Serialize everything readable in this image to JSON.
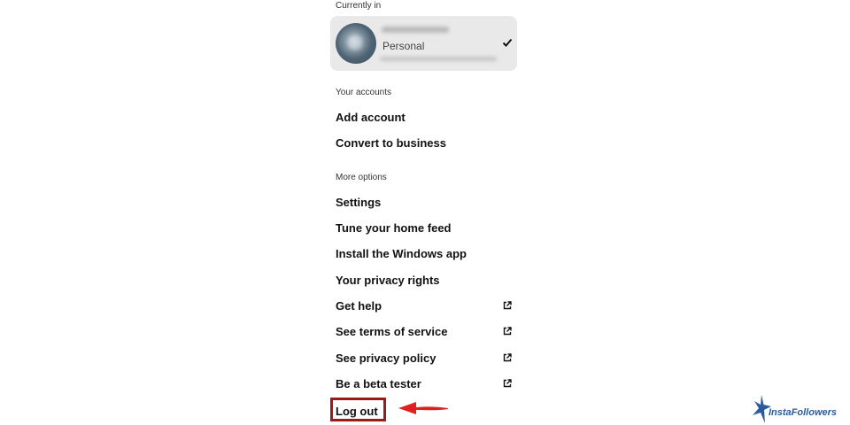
{
  "sections": {
    "currently_in": "Currently in",
    "your_accounts": "Your accounts",
    "more_options": "More options"
  },
  "account": {
    "type": "Personal",
    "selected": true
  },
  "accounts_items": [
    {
      "label": "Add account"
    },
    {
      "label": "Convert to business"
    }
  ],
  "options_items": [
    {
      "label": "Settings",
      "external": false
    },
    {
      "label": "Tune your home feed",
      "external": false
    },
    {
      "label": "Install the Windows app",
      "external": false
    },
    {
      "label": "Your privacy rights",
      "external": false
    },
    {
      "label": "Get help",
      "external": true
    },
    {
      "label": "See terms of service",
      "external": true
    },
    {
      "label": "See privacy policy",
      "external": true
    },
    {
      "label": "Be a beta tester",
      "external": true
    }
  ],
  "logout": {
    "label": "Log out"
  },
  "brand": {
    "name": "InstaFollowers"
  },
  "colors": {
    "highlight_border": "#9e1a1a",
    "arrow": "#e02020",
    "brand": "#2a5b9e",
    "card_bg": "#e9e9e9"
  }
}
